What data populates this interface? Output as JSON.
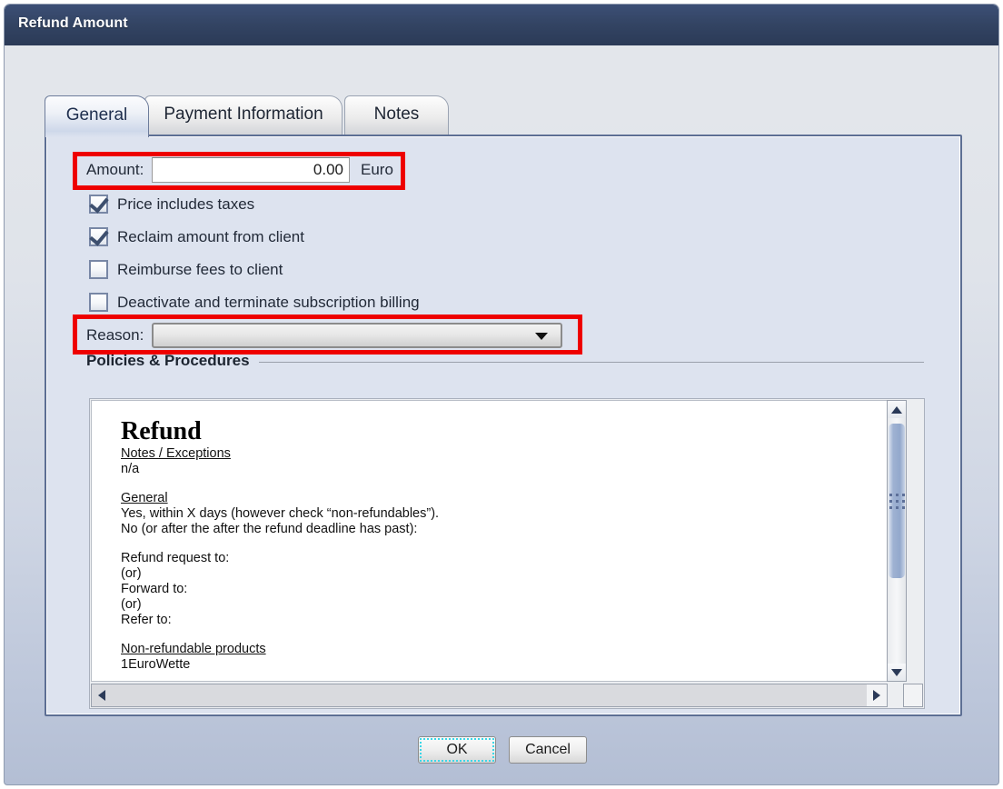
{
  "window": {
    "title": "Refund Amount"
  },
  "tabs": [
    {
      "label": "General",
      "active": true
    },
    {
      "label": "Payment Information",
      "active": false
    },
    {
      "label": "Notes",
      "active": false
    }
  ],
  "general_tab": {
    "amount": {
      "label": "Amount:",
      "value": "0.00",
      "placeholder": "",
      "currency": "Euro"
    },
    "checkboxes": [
      {
        "label": "Price includes taxes",
        "checked": true
      },
      {
        "label": "Reclaim amount from client",
        "checked": true
      },
      {
        "label": "Reimburse fees to client",
        "checked": false
      },
      {
        "label": "Deactivate and terminate subscription billing",
        "checked": false
      }
    ],
    "reason": {
      "label": "Reason:",
      "value": "",
      "options": []
    },
    "policies_group": {
      "title": "Policies & Procedures",
      "document": {
        "heading": "Refund",
        "section_1_title": "Notes / Exceptions",
        "section_1_body": "n/a",
        "section_2_title": "General",
        "section_2_line_1": "Yes, within X days (however check “non-refundables”).",
        "section_2_line_2": "No (or after the after the refund deadline has past):",
        "section_3_line_1": "Refund request to:",
        "section_3_line_2": "(or)",
        "section_3_line_3": "Forward to:",
        "section_3_line_4": "(or)",
        "section_3_line_5": "Refer to:",
        "section_4_title": "Non-refundable products",
        "section_4_body": "1EuroWette"
      }
    }
  },
  "footer": {
    "ok_label": "OK",
    "cancel_label": "Cancel"
  },
  "annotations": {
    "highlight_color": "#ee0000",
    "highlighted_fields": [
      "Amount:",
      "Reason:"
    ]
  },
  "colors": {
    "titlebar": "#334463",
    "panel": "#dde3ef",
    "dialog_background": "#dfe3ea",
    "accent_focus": "#39d7e8"
  }
}
